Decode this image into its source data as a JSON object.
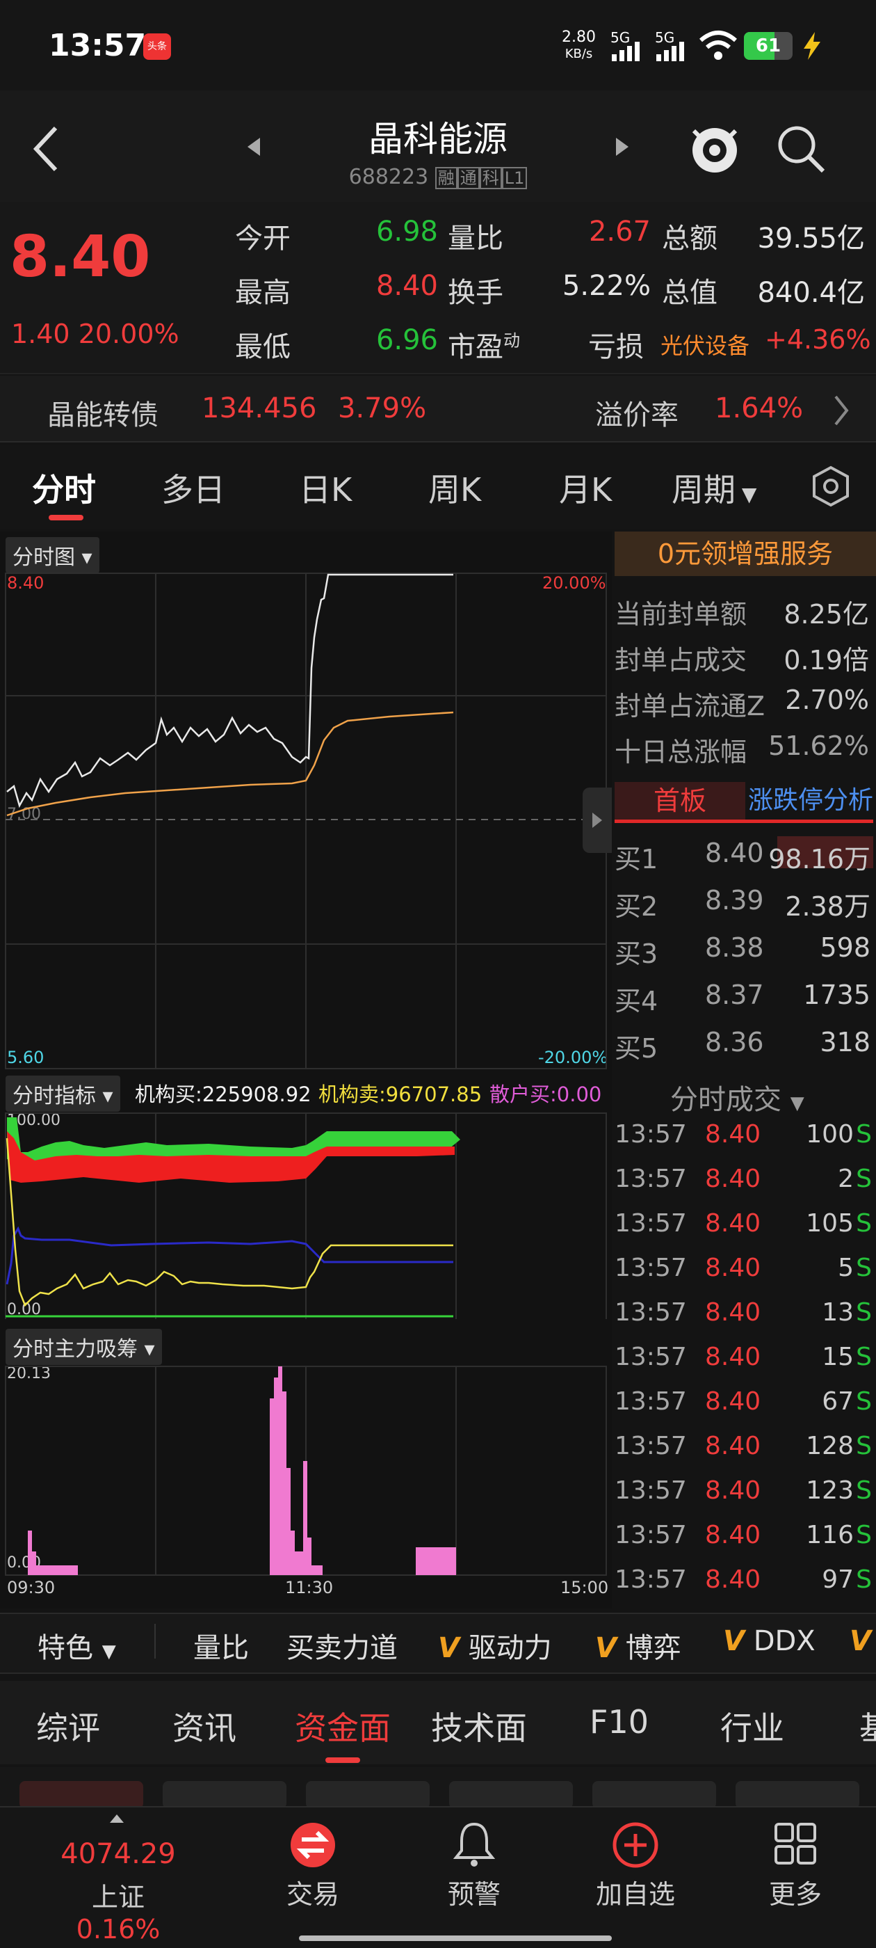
{
  "status": {
    "time": "13:57",
    "app_tag": "头条",
    "net_speed": "2.80",
    "net_unit": "KB/s",
    "sig1": "5G",
    "sig2": "5G",
    "battery": "61"
  },
  "header": {
    "title": "晶科能源",
    "code": "688223",
    "tags": [
      "融",
      "通",
      "科",
      "L1"
    ]
  },
  "quote": {
    "price": "8.40",
    "change": "1.40",
    "change_pct": "20.00%",
    "rows": [
      {
        "l1": "今开",
        "v1": "6.98",
        "l2": "量比",
        "v2": "2.67",
        "l3": "总额",
        "v3": "39.55亿"
      },
      {
        "l1": "最高",
        "v1": "8.40",
        "l2": "换手",
        "v2": "5.22%",
        "l3": "总值",
        "v3": "840.4亿"
      },
      {
        "l1": "最低",
        "v1": "6.96",
        "l2": "市盈",
        "l2sup": "动",
        "v2": "",
        "l3": "亏损",
        "v3": ""
      }
    ],
    "sector": "光伏设备",
    "sector_pct": "+4.36%"
  },
  "bond": {
    "name": "晶能转债",
    "price": "134.456",
    "pct": "3.79%",
    "premium_label": "溢价率",
    "premium": "1.64%"
  },
  "tabs": [
    "分时",
    "多日",
    "日K",
    "周K",
    "月K",
    "周期"
  ],
  "main_chart": {
    "selector": "分时图",
    "ymax": "8.40",
    "ymin": "5.60",
    "pmax": "20.00%",
    "pmin": "-20.00%",
    "prev_label": "7.00"
  },
  "indicator": {
    "selector": "分时指标",
    "inst_buy": "机构买:225908.92",
    "inst_sell": "机构卖:96707.85",
    "retail_buy": "散户买:0.00",
    "top": "100.00",
    "bottom": "0.00"
  },
  "absorb": {
    "selector": "分时主力吸筹",
    "top": "20.13",
    "bottom": "0.00",
    "t_start": "09:30",
    "t_mid": "11:30",
    "t_end": "15:00"
  },
  "side": {
    "promo": "0元领增强服务",
    "stats": [
      {
        "k": "当前封单额",
        "v": "8.25亿"
      },
      {
        "k": "封单占成交",
        "v": "0.19倍"
      },
      {
        "k": "封单占流通Z",
        "v": "2.70%"
      },
      {
        "k": "十日总涨幅",
        "v": "51.62%"
      }
    ],
    "tab1": "首板",
    "tab2": "涨跌停分析",
    "bids": [
      {
        "k": "买1",
        "p": "8.40",
        "v": "98.16万"
      },
      {
        "k": "买2",
        "p": "8.39",
        "v": "2.38万"
      },
      {
        "k": "买3",
        "p": "8.38",
        "v": "598"
      },
      {
        "k": "买4",
        "p": "8.37",
        "v": "1735"
      },
      {
        "k": "买5",
        "p": "8.36",
        "v": "318"
      }
    ],
    "trades_title": "分时成交",
    "trades": [
      {
        "t": "13:57",
        "p": "8.40",
        "v": "100",
        "s": "S"
      },
      {
        "t": "13:57",
        "p": "8.40",
        "v": "2",
        "s": "S"
      },
      {
        "t": "13:57",
        "p": "8.40",
        "v": "105",
        "s": "S"
      },
      {
        "t": "13:57",
        "p": "8.40",
        "v": "5",
        "s": "S"
      },
      {
        "t": "13:57",
        "p": "8.40",
        "v": "13",
        "s": "S"
      },
      {
        "t": "13:57",
        "p": "8.40",
        "v": "15",
        "s": "S"
      },
      {
        "t": "13:57",
        "p": "8.40",
        "v": "67",
        "s": "S"
      },
      {
        "t": "13:57",
        "p": "8.40",
        "v": "128",
        "s": "S"
      },
      {
        "t": "13:57",
        "p": "8.40",
        "v": "123",
        "s": "S"
      },
      {
        "t": "13:57",
        "p": "8.40",
        "v": "116",
        "s": "S"
      },
      {
        "t": "13:57",
        "p": "8.40",
        "v": "97",
        "s": "S"
      }
    ]
  },
  "indicators": {
    "first": "特色",
    "items": [
      "量比",
      "买卖力道",
      "驱动力",
      "博弈",
      "DDX"
    ]
  },
  "bottom_tabs": [
    "综评",
    "资讯",
    "资金面",
    "技术面",
    "F10",
    "行业",
    "基"
  ],
  "bottom_nav": {
    "index_value": "4074.29",
    "index_name": "上证",
    "index_pct": "0.16%",
    "items": [
      "交易",
      "预警",
      "加自选",
      "更多"
    ]
  }
}
